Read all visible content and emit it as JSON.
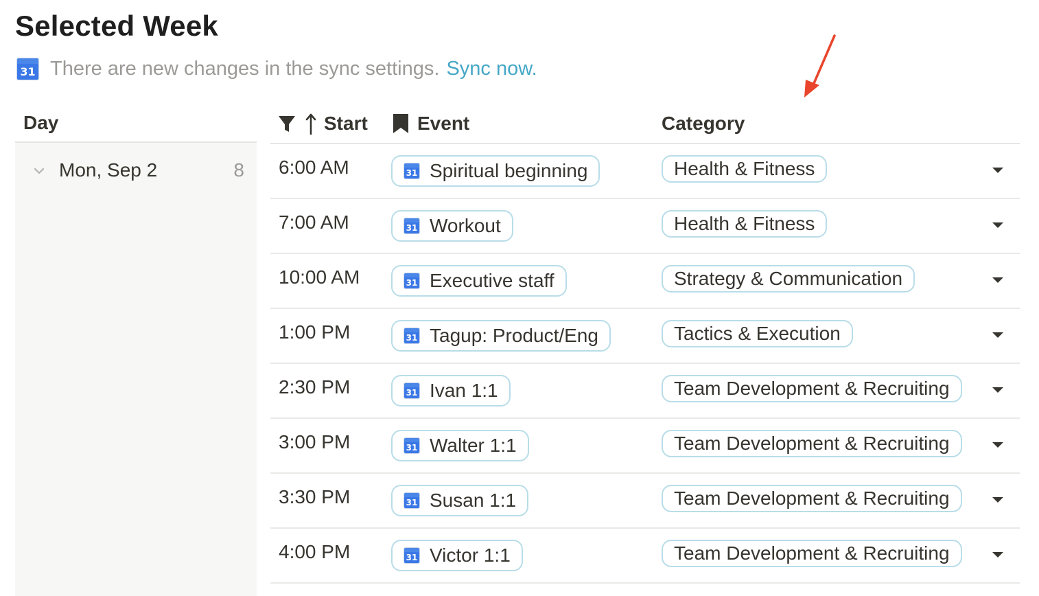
{
  "page": {
    "title": "Selected Week"
  },
  "sync": {
    "icon": "google-calendar-icon",
    "icon_day": "31",
    "message": "There are new changes in the sync settings.",
    "link_label": "Sync now."
  },
  "day_column": {
    "header": "Day",
    "groups": [
      {
        "label": "Mon, Sep 2",
        "count": "8",
        "expanded": true
      }
    ]
  },
  "table": {
    "columns": {
      "start": "Start",
      "event": "Event",
      "category": "Category"
    },
    "rows": [
      {
        "start": "6:00 AM",
        "event": "Spiritual beginning",
        "category": "Health & Fitness"
      },
      {
        "start": "7:00 AM",
        "event": "Workout",
        "category": "Health & Fitness"
      },
      {
        "start": "10:00 AM",
        "event": "Executive staff",
        "category": "Strategy & Communication"
      },
      {
        "start": "1:00 PM",
        "event": "Tagup: Product/Eng",
        "category": "Tactics & Execution"
      },
      {
        "start": "2:30 PM",
        "event": "Ivan 1:1",
        "category": "Team Development & Recruiting"
      },
      {
        "start": "3:00 PM",
        "event": "Walter 1:1",
        "category": "Team Development & Recruiting"
      },
      {
        "start": "3:30 PM",
        "event": "Susan 1:1",
        "category": "Team Development & Recruiting"
      },
      {
        "start": "4:00 PM",
        "event": "Victor 1:1",
        "category": "Team Development & Recruiting"
      }
    ]
  },
  "colors": {
    "link": "#46a7c6",
    "pill_border": "#b8dde8",
    "group_panel_bg": "#f7f7f5",
    "annotation_arrow": "#e8452c"
  }
}
